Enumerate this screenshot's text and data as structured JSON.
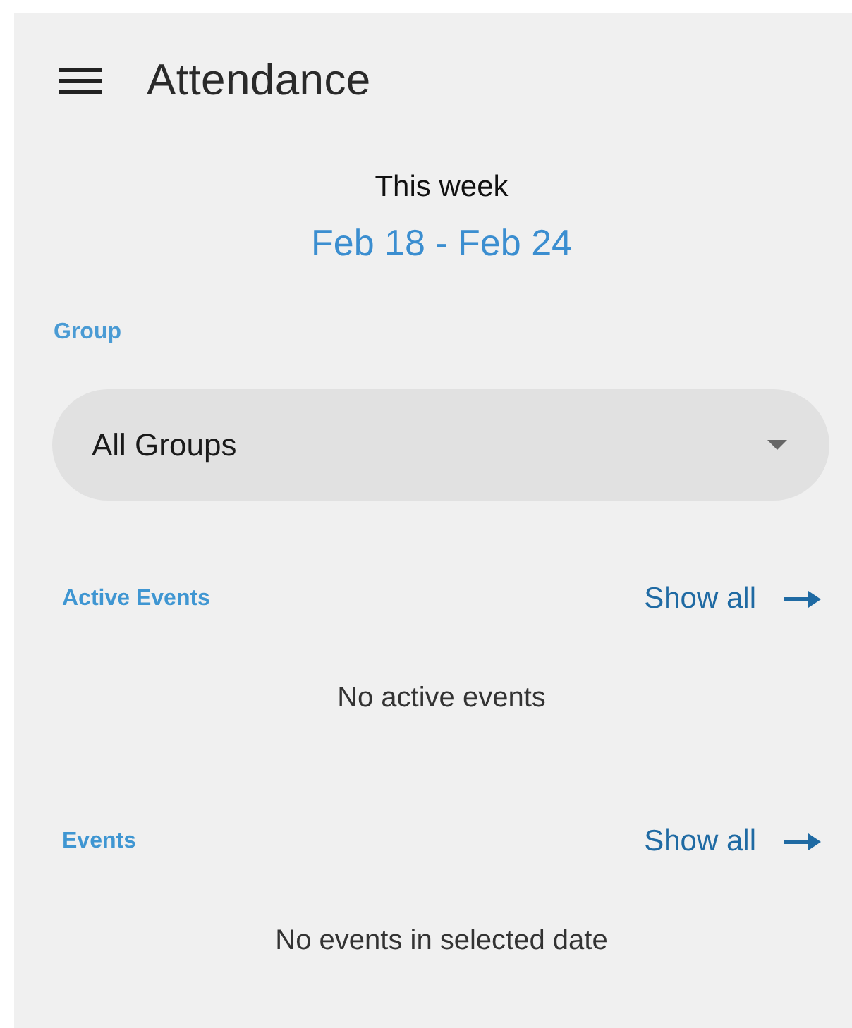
{
  "app_bar": {
    "title": "Attendance"
  },
  "week": {
    "label": "This week",
    "range": "Feb 18 - Feb 24"
  },
  "group": {
    "label": "Group",
    "value": "All Groups"
  },
  "sections": [
    {
      "title": "Active Events",
      "link": "Show all",
      "empty_text": "No active events"
    },
    {
      "title": "Events",
      "link": "Show all",
      "empty_text": "No events in selected date"
    }
  ]
}
